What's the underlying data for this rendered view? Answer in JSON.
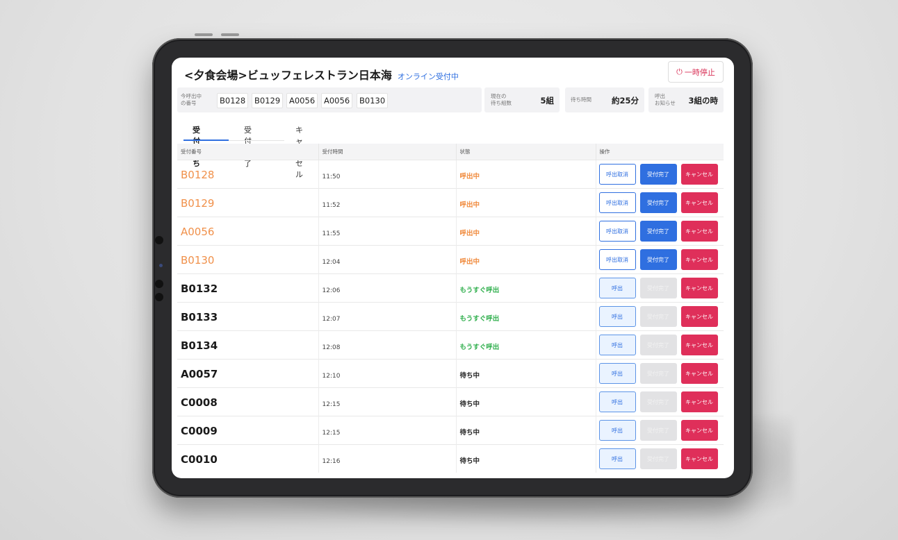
{
  "header": {
    "title": "<夕食会場>ビュッフェレストラン日本海",
    "status": "オンライン受付中",
    "pause_label": "一時停止",
    "pause_icon": "power-icon"
  },
  "info": {
    "calling_label_1": "今呼出中",
    "calling_label_2": "の番号",
    "calling_numbers": [
      "B0128",
      "B0129",
      "A0056",
      "A0056",
      "B0130"
    ],
    "waiting_groups_label_1": "現在の",
    "waiting_groups_label_2": "待ち組数",
    "waiting_groups_value": "5組",
    "wait_time_label": "待ち時間",
    "wait_time_value": "約25分",
    "notify_label_1": "呼出",
    "notify_label_2": "お知らせ",
    "notify_value": "3組の時"
  },
  "tabs": [
    "受付待ち",
    "受付完了",
    "キャンセル"
  ],
  "table": {
    "headers": [
      "受付番号",
      "受付時間",
      "状態",
      "操作"
    ],
    "rows": [
      {
        "number": "B0128",
        "time": "11:50",
        "status": "呼出中",
        "state": "calling"
      },
      {
        "number": "B0129",
        "time": "11:52",
        "status": "呼出中",
        "state": "calling"
      },
      {
        "number": "A0056",
        "time": "11:55",
        "status": "呼出中",
        "state": "calling"
      },
      {
        "number": "B0130",
        "time": "12:04",
        "status": "呼出中",
        "state": "calling"
      },
      {
        "number": "B0132",
        "time": "12:06",
        "status": "もうすぐ呼出",
        "state": "soon"
      },
      {
        "number": "B0133",
        "time": "12:07",
        "status": "もうすぐ呼出",
        "state": "soon"
      },
      {
        "number": "B0134",
        "time": "12:08",
        "status": "もうすぐ呼出",
        "state": "soon"
      },
      {
        "number": "A0057",
        "time": "12:10",
        "status": "待ち中",
        "state": "wait"
      },
      {
        "number": "C0008",
        "time": "12:15",
        "status": "待ち中",
        "state": "wait"
      },
      {
        "number": "C0009",
        "time": "12:15",
        "status": "待ち中",
        "state": "wait"
      },
      {
        "number": "C0010",
        "time": "12:16",
        "status": "待ち中",
        "state": "wait"
      }
    ]
  },
  "actions": {
    "cancel_call": "呼出取消",
    "call": "呼出",
    "complete": "受付完了",
    "cancel": "キャンセル"
  },
  "colors": {
    "accent": "#2f6fe0",
    "danger": "#df2f5a",
    "calling": "#f08a3c",
    "soon": "#32b04f"
  }
}
